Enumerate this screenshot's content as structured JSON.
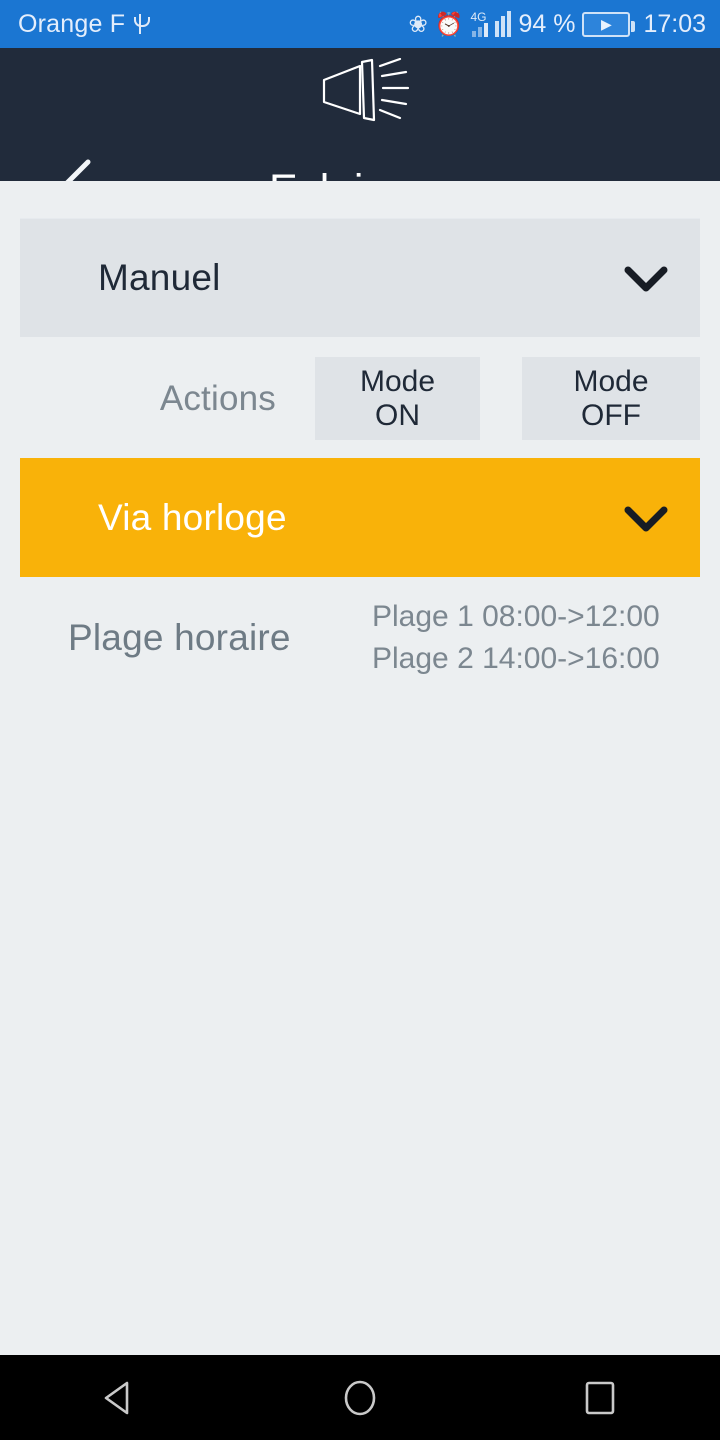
{
  "status_bar": {
    "carrier": "Orange F",
    "usb_icon": "usb-icon",
    "bluetooth_icon": "bluetooth-icon",
    "alarm_icon": "alarm-icon",
    "network_type": "4G",
    "signal_icon": "signal-bars-icon",
    "battery_percent": "94 %",
    "battery_icon": "battery-charging-icon",
    "time": "17:03",
    "background_color": "#1b76d2"
  },
  "app_bar": {
    "title": "Eclairage",
    "lamp_icon": "lamp-icon",
    "back_icon": "back-chevron-icon",
    "background_color": "#212b3b"
  },
  "main": {
    "mode_card": {
      "label": "Manuel",
      "chevron_icon": "chevron-down-icon",
      "background_color": "#dfe3e7"
    },
    "actions": {
      "label": "Actions",
      "buttons": [
        {
          "line1": "Mode",
          "line2": "ON"
        },
        {
          "line1": "Mode",
          "line2": "OFF"
        }
      ]
    },
    "clock_card": {
      "label": "Via horloge",
      "chevron_icon": "chevron-down-icon",
      "background_color": "#f9b209"
    },
    "schedule": {
      "title": "Plage horaire",
      "ranges": [
        "Plage 1 08:00->12:00",
        "Plage 2 14:00->16:00"
      ]
    },
    "background_color": "#eceff1"
  },
  "nav_bar": {
    "back_icon": "nav-back-triangle-icon",
    "home_icon": "nav-home-circle-icon",
    "recents_icon": "nav-recents-square-icon",
    "background_color": "#000000"
  }
}
